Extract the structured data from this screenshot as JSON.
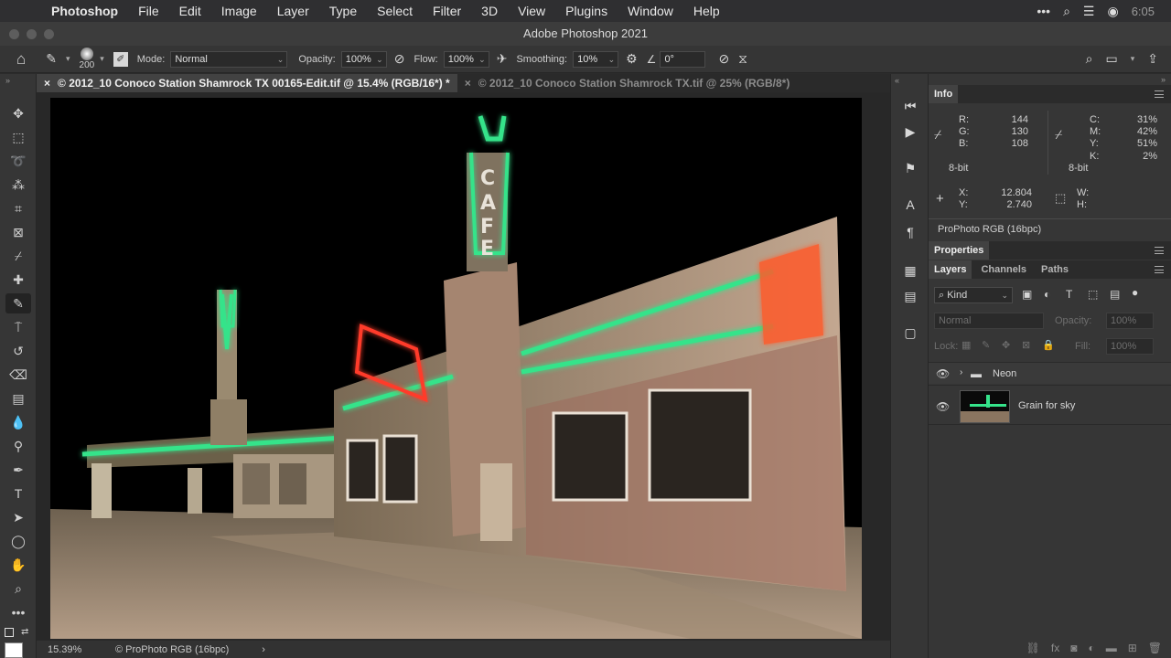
{
  "menubar": {
    "apple_icon": "apple-icon",
    "app_name": "Photoshop",
    "items": [
      "File",
      "Edit",
      "Image",
      "Layer",
      "Type",
      "Select",
      "Filter",
      "3D",
      "View",
      "Plugins",
      "Window",
      "Help"
    ],
    "clock": "6:05"
  },
  "window": {
    "title": "Adobe Photoshop 2021"
  },
  "options": {
    "brush_size": "200",
    "mode_label": "Mode:",
    "mode_value": "Normal",
    "opacity_label": "Opacity:",
    "opacity_value": "100%",
    "flow_label": "Flow:",
    "flow_value": "100%",
    "smoothing_label": "Smoothing:",
    "smoothing_value": "10%",
    "angle_value": "0°"
  },
  "tabs": [
    {
      "close": "×",
      "label": "© 2012_10 Conoco Station Shamrock TX 00165-Edit.tif @ 15.4% (RGB/16*) *"
    },
    {
      "close": "×",
      "label": "© 2012_10 Conoco Station Shamrock TX.tif @ 25% (RGB/8*)"
    }
  ],
  "status": {
    "zoom": "15.39%",
    "profile": "© ProPhoto RGB (16bpc)",
    "arrow": "›"
  },
  "info_panel": {
    "tab": "Info",
    "r_label": "R:",
    "r": "144",
    "g_label": "G:",
    "g": "130",
    "b_label": "B:",
    "b": "108",
    "c_label": "C:",
    "c": "31%",
    "m_label": "M:",
    "m": "42%",
    "y_label": "Y:",
    "y": "51%",
    "k_label": "K:",
    "k": "2%",
    "bitdepth_left": "8-bit",
    "bitdepth_right": "8-bit",
    "x_label": "X:",
    "x": "12.804",
    "y2_label": "Y:",
    "y2": "2.740",
    "w_label": "W:",
    "h_label": "H:",
    "profile": "ProPhoto RGB (16bpc)"
  },
  "properties_panel": {
    "tab": "Properties"
  },
  "layers_panel": {
    "tabs": [
      "Layers",
      "Channels",
      "Paths"
    ],
    "filter_kind": "Kind",
    "blend_mode": "Normal",
    "opacity_label": "Opacity:",
    "opacity_value": "100%",
    "lock_label": "Lock:",
    "fill_label": "Fill:",
    "fill_value": "100%",
    "layers": [
      {
        "name": "Neon",
        "type": "group"
      },
      {
        "name": "Grain for sky",
        "type": "pixel"
      }
    ]
  },
  "colors": {
    "accent_green": "#35e38a",
    "accent_red": "#ff3b2a",
    "panel_bg": "#363636"
  }
}
